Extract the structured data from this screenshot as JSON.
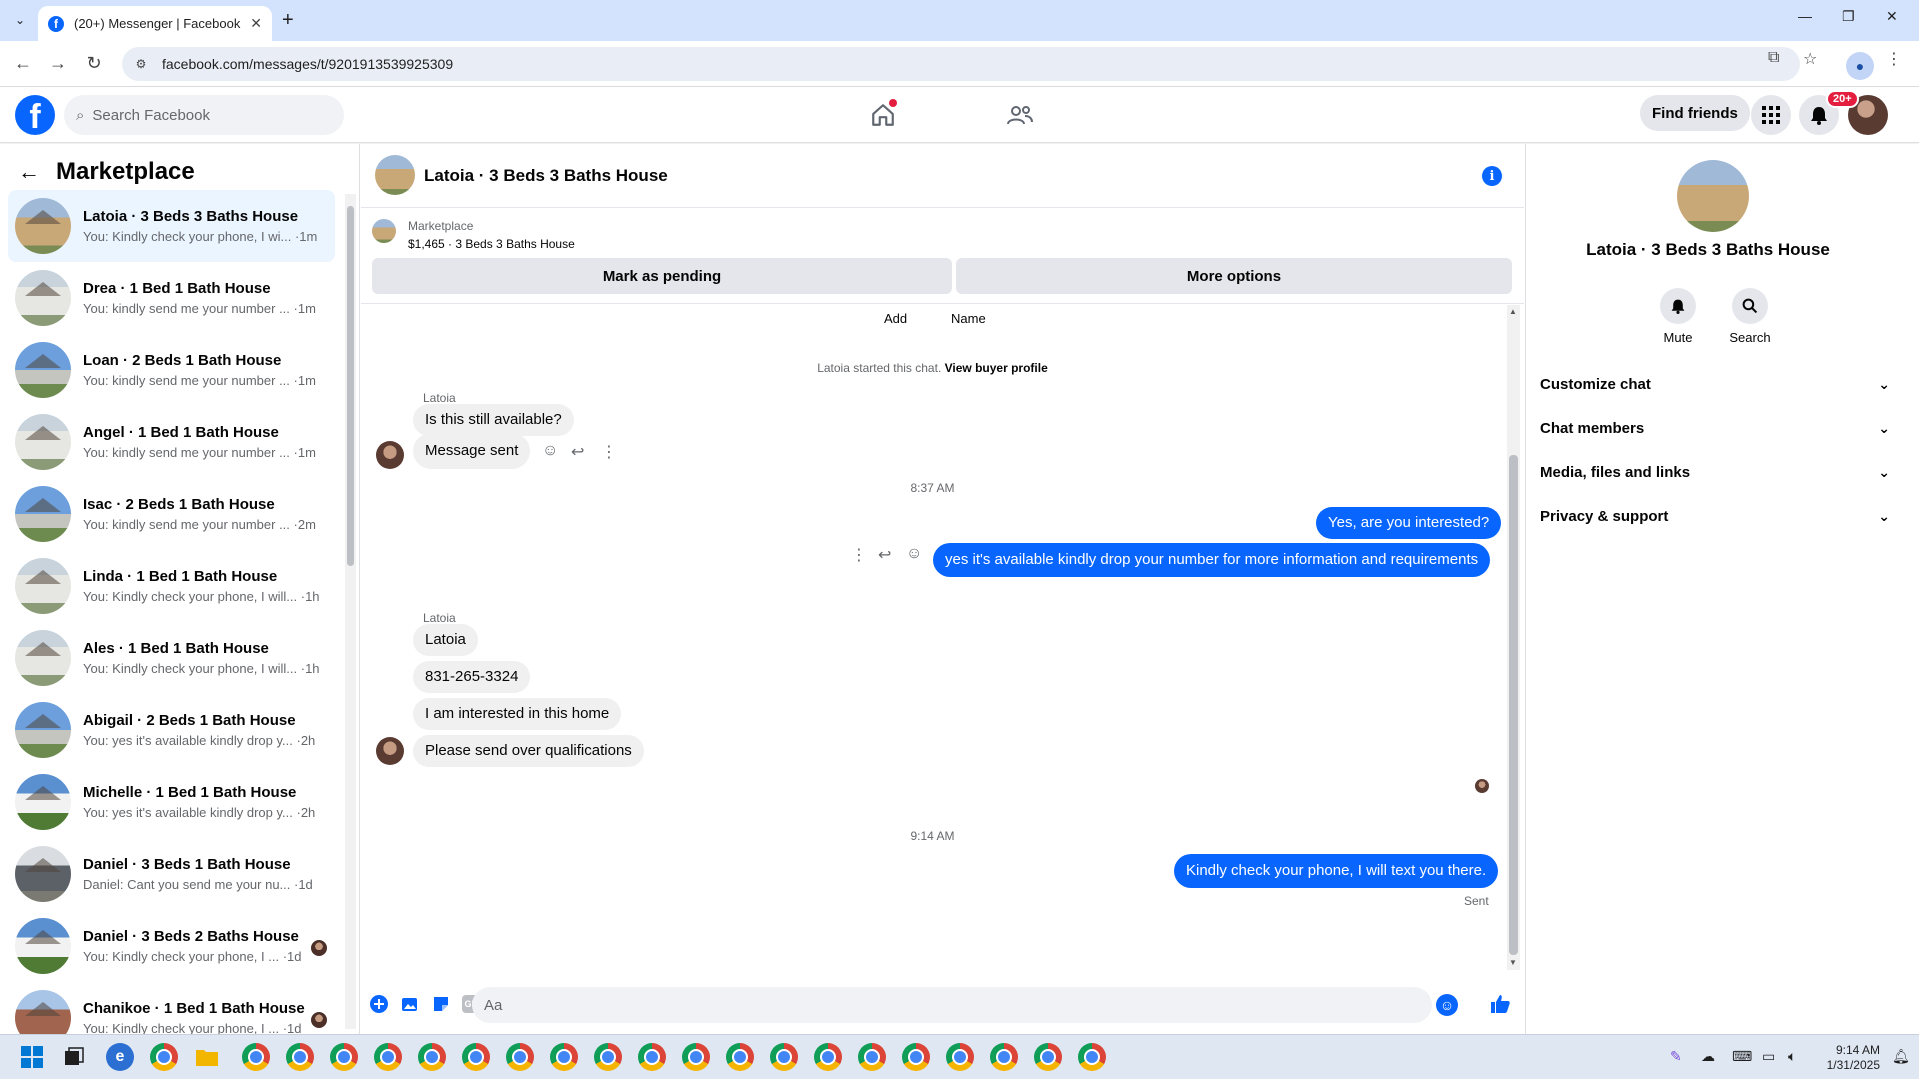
{
  "browser": {
    "tab_title": "(20+) Messenger | Facebook",
    "url": "facebook.com/messages/t/9201913539925309"
  },
  "fb": {
    "search_placeholder": "Search Facebook",
    "find_friends": "Find friends",
    "notif_count": "20+"
  },
  "sidebar": {
    "title": "Marketplace",
    "conversations": [
      {
        "name": "Latoia · 3 Beds 3 Baths House",
        "preview": "You: Kindly check your phone, I wi... ·1m",
        "thumb": "house-tan"
      },
      {
        "name": "Drea · 1 Bed 1 Bath House",
        "preview": "You: kindly send me your number ... ·1m",
        "thumb": "house-white"
      },
      {
        "name": "Loan · 2 Beds 1 Bath House",
        "preview": "You: kindly send me your number ... ·1m",
        "thumb": "house-blue"
      },
      {
        "name": "Angel · 1 Bed 1 Bath House",
        "preview": "You: kindly send me your number ... ·1m",
        "thumb": "house-white"
      },
      {
        "name": "Isac · 2 Beds 1 Bath House",
        "preview": "You: kindly send me your number ... ·2m",
        "thumb": "house-blue"
      },
      {
        "name": "Linda · 1 Bed 1 Bath House",
        "preview": "You: Kindly check your phone, I will... ·1h",
        "thumb": "house-white"
      },
      {
        "name": "Ales · 1 Bed 1 Bath House",
        "preview": "You: Kindly check your phone, I will... ·1h",
        "thumb": "house-white"
      },
      {
        "name": "Abigail · 2 Beds 1 Bath House",
        "preview": "You: yes it's available kindly drop y... ·2h",
        "thumb": "house-blue"
      },
      {
        "name": "Michelle · 1 Bed 1 Bath House",
        "preview": "You: yes it's available kindly drop y... ·2h",
        "thumb": "house-green"
      },
      {
        "name": "Daniel · 3 Beds 1 Bath House",
        "preview": "Daniel: Cant you send me your nu... ·1d",
        "thumb": "house-dark"
      },
      {
        "name": "Daniel · 3 Beds 2 Baths House",
        "preview": "You: Kindly check your phone, I ... ·1d",
        "thumb": "house-green"
      },
      {
        "name": "Chanikoe · 1 Bed 1 Bath House",
        "preview": "You: Kindly check your phone, I ... ·1d",
        "thumb": "house-brick"
      }
    ]
  },
  "chat": {
    "title": "Latoia · 3 Beds 3 Baths House",
    "marketplace_label": "Marketplace",
    "listing": "$1,465 · 3 Beds 3 Baths House",
    "mark_pending": "Mark as pending",
    "more_options": "More options",
    "add_label": "Add",
    "name_label": "Name",
    "started_text": "Latoia started this chat.",
    "view_profile": "View buyer profile",
    "sender_name": "Latoia",
    "msg_in_1": "Is this still available?",
    "msg_in_2": "Message sent",
    "time_1": "8:37 AM",
    "msg_out_1": "Yes, are you interested?",
    "msg_out_2": "yes it's available kindly drop your number for more information and requirements",
    "msg_in_3": "Latoia",
    "msg_in_4": "831-265-3324",
    "msg_in_5": "I am interested in this home",
    "msg_in_6": "Please send over qualifications",
    "time_2": "9:14 AM",
    "msg_out_3": "Kindly check your phone, I will text you there.",
    "sent_status": "Sent",
    "composer_placeholder": "Aa",
    "gif_label": "GIF"
  },
  "details": {
    "title": "Latoia · 3 Beds 3 Baths House",
    "mute": "Mute",
    "search": "Search",
    "sections": [
      "Customize chat",
      "Chat members",
      "Media, files and links",
      "Privacy & support"
    ]
  },
  "taskbar": {
    "time": "9:14 AM",
    "date": "1/31/2025"
  },
  "colors": {
    "accent": "#0866ff",
    "active_conv": "#ebf5ff",
    "badge": "#e41e3f"
  }
}
